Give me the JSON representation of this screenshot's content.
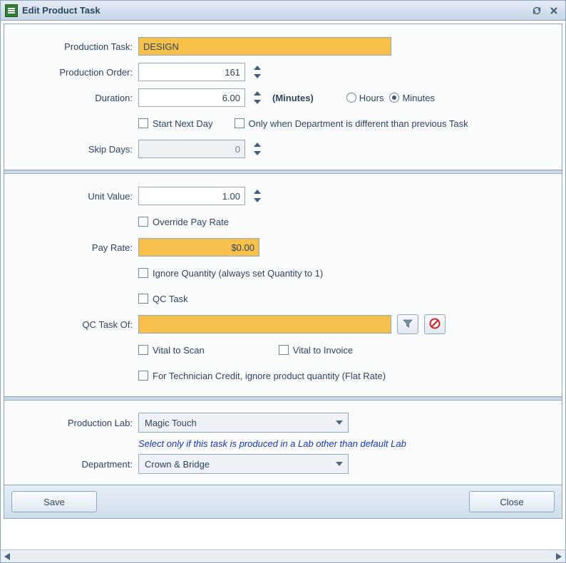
{
  "title": "Edit Product Task",
  "labels": {
    "production_task": "Production Task:",
    "production_order": "Production Order:",
    "duration": "Duration:",
    "skip_days": "Skip Days:",
    "unit_value": "Unit Value:",
    "pay_rate": "Pay Rate:",
    "qc_task_of": "QC Task Of:",
    "production_lab": "Production Lab:",
    "department": "Department:"
  },
  "values": {
    "production_task": "DESIGN",
    "production_order": "161",
    "duration": "6.00",
    "duration_units_label": "(Minutes)",
    "skip_days": "0",
    "unit_value": "1.00",
    "pay_rate": "$0.00",
    "qc_task_of": "",
    "production_lab": "Magic Touch",
    "department": "Crown & Bridge"
  },
  "checks": {
    "start_next_day": "Start Next Day",
    "only_when_dept_diff": "Only when Department is different than previous Task",
    "override_pay_rate": "Override Pay Rate",
    "ignore_quantity": "Ignore Quantity (always set Quantity to 1)",
    "qc_task": "QC Task",
    "vital_to_scan": "Vital to Scan",
    "vital_to_invoice": "Vital to Invoice",
    "flat_rate": "For Technician Credit, ignore product quantity (Flat Rate)"
  },
  "radios": {
    "hours": "Hours",
    "minutes": "Minutes"
  },
  "help": {
    "production_lab": "Select only if this task is produced in a Lab other than default Lab"
  },
  "buttons": {
    "save": "Save",
    "close": "Close"
  },
  "colors": {
    "highlight": "#f7c04a",
    "link": "#1033cc"
  }
}
